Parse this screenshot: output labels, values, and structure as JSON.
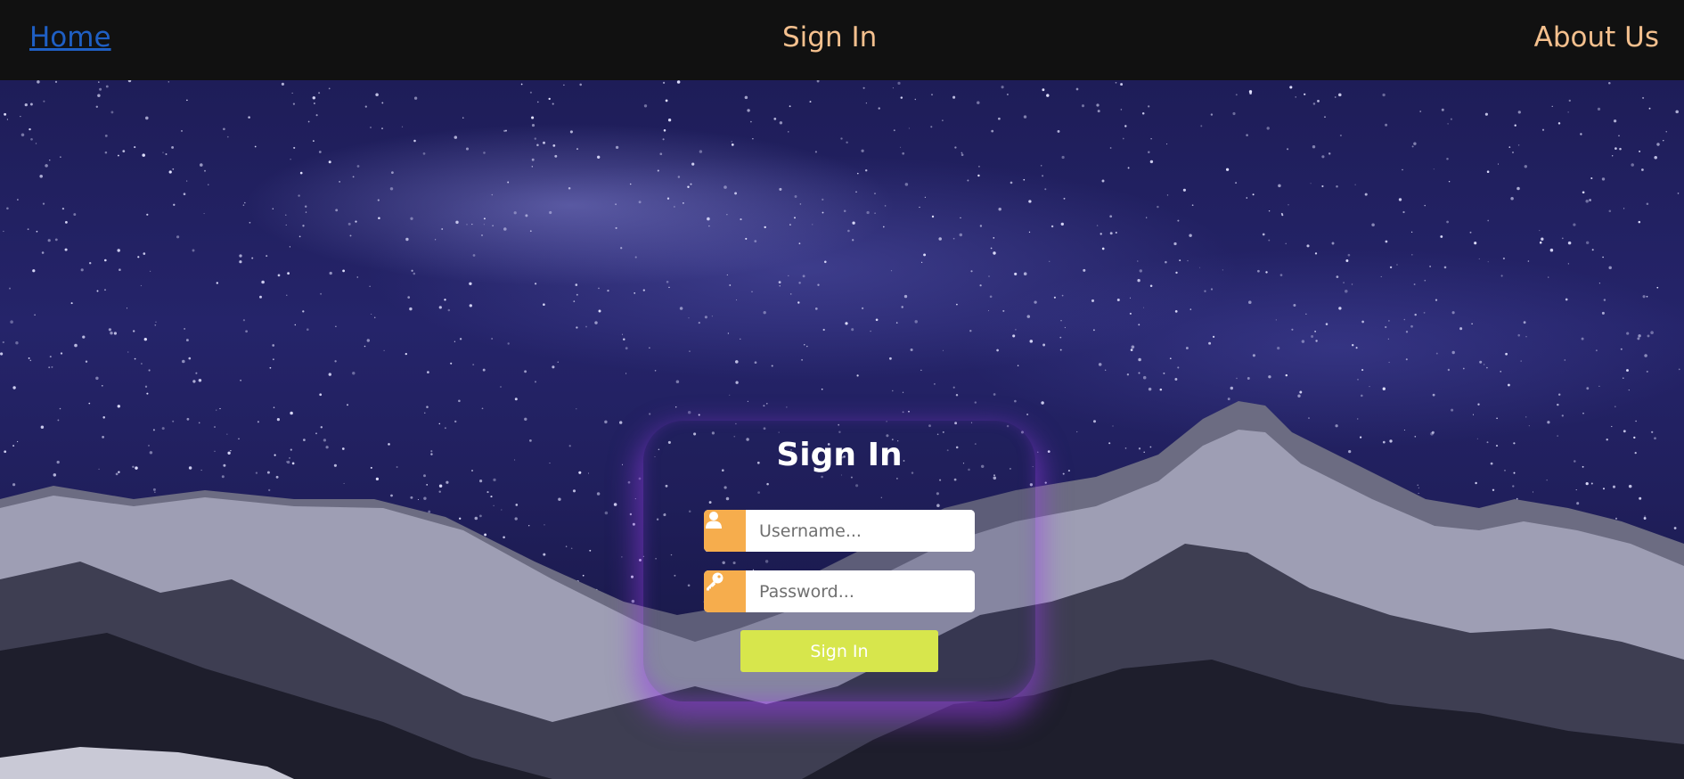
{
  "nav": {
    "home_label": "Home",
    "signin_label": "Sign In",
    "about_label": "About Us",
    "home_color": "#1f5fc4",
    "link_color": "#f4c08e"
  },
  "login": {
    "title": "Sign In",
    "username_placeholder": "Username...",
    "password_placeholder": "Password...",
    "submit_label": "Sign In",
    "username_icon": "user-icon",
    "password_icon": "key-icon",
    "addon_color": "#f6ad4d",
    "button_color": "#d7e64c",
    "glow_color": "#9a3ee6"
  },
  "background": {
    "description_icon": "starry-sky-mountains-image"
  }
}
